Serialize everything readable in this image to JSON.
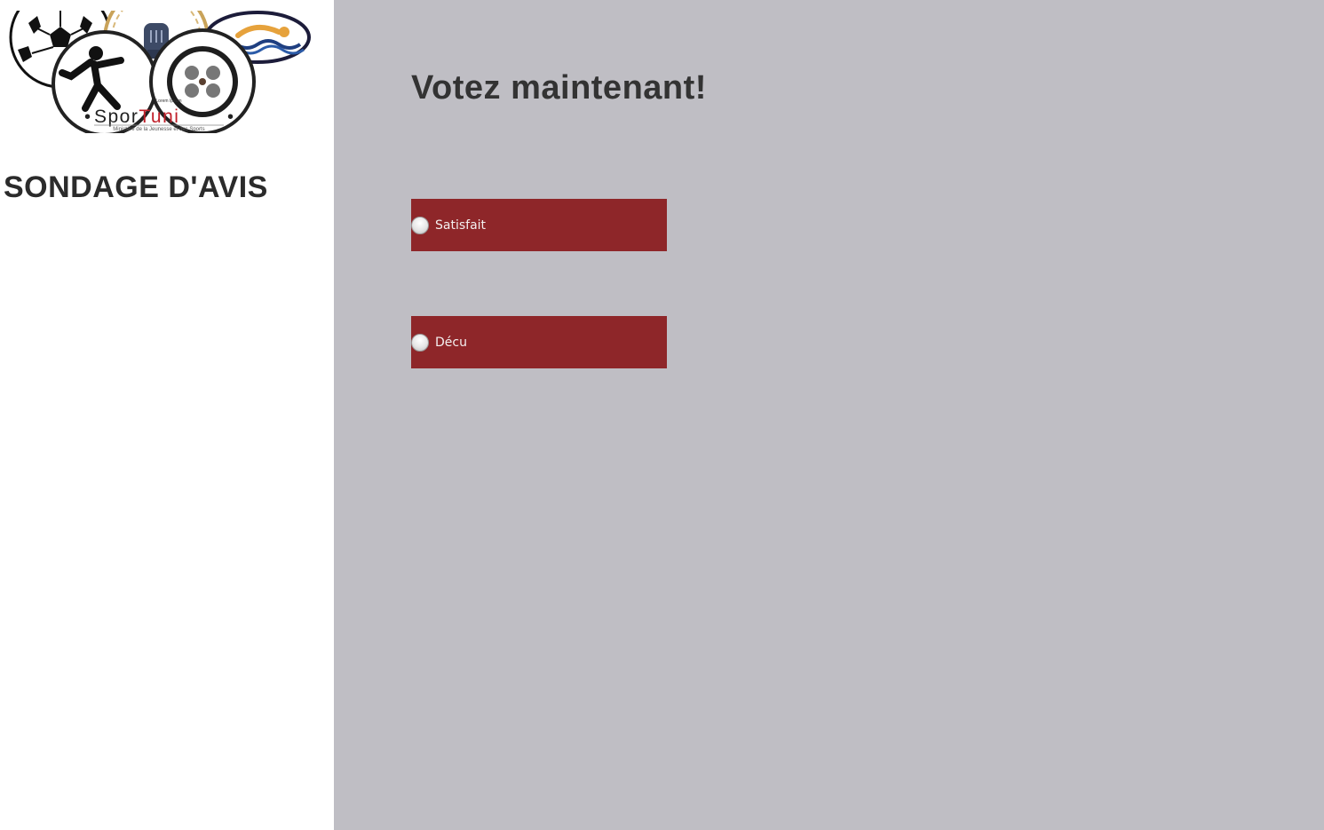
{
  "logo": {
    "brand_prefix": "Spor",
    "brand_suffix": "Tuni",
    "tagline": "Ministère de la Jeunesse et des Sports",
    "small_text": "Lorem Ipsum",
    "icons": [
      "football-icon",
      "boxing-glove-icon",
      "swimmer-icon",
      "karate-icon",
      "film-reel-icon"
    ]
  },
  "sidebar": {
    "title": "SONDAGE D'AVIS"
  },
  "main": {
    "heading": "Votez maintenant!",
    "options": [
      {
        "label": "Satisfait",
        "selected": false
      },
      {
        "label": "Décu",
        "selected": false
      }
    ]
  },
  "colors": {
    "sidebar_bg": "#ffffff",
    "main_bg": "#bfbec4",
    "option_bg": "#8e2629",
    "heading_text": "#333333",
    "brand_accent": "#c0202a"
  }
}
